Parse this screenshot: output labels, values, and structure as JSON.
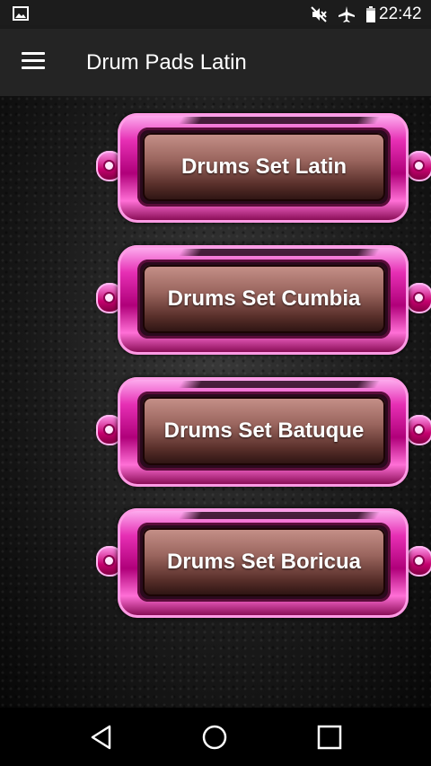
{
  "status_bar": {
    "time": "22:42",
    "icons": [
      "gallery-icon",
      "mute-icon",
      "airplane-icon",
      "battery-icon"
    ]
  },
  "app_bar": {
    "title": "Drum Pads Latin",
    "menu_icon": "menu-icon"
  },
  "menu": {
    "items": [
      {
        "label": "Drums Set Latin"
      },
      {
        "label": "Drums Set Cumbia"
      },
      {
        "label": "Drums Set Batuque"
      },
      {
        "label": "Drums Set Boricua"
      }
    ]
  },
  "nav_bar": {
    "icons": [
      "back-icon",
      "home-icon",
      "recents-icon"
    ]
  },
  "colors": {
    "pad_frame": "#e62fb4",
    "pad_face": "#9a655e",
    "app_bar": "#242424"
  }
}
